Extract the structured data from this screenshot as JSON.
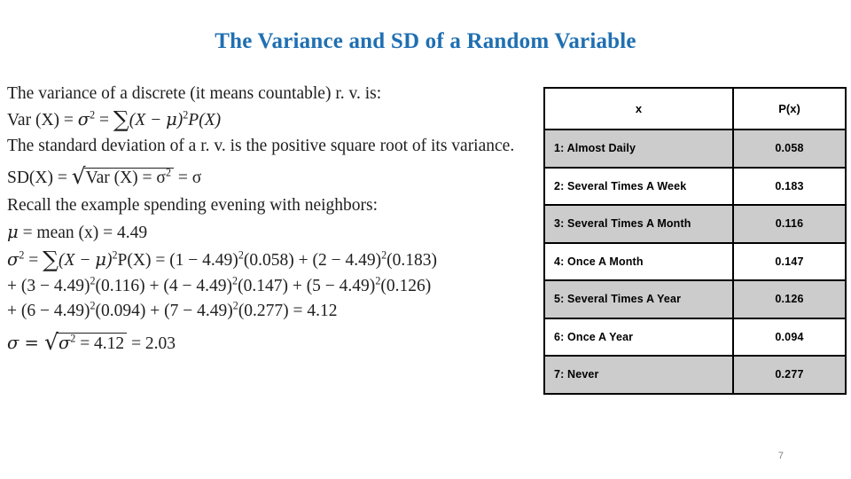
{
  "slide": {
    "title": "The Variance and SD of a Random Variable",
    "title_color": "#1F6FB2",
    "page_number": "7"
  },
  "body": {
    "line_variance_intro": "The variance of a discrete (it means countable) r. v. is:",
    "line_var_formula_lhs": "Var (X) = ",
    "line_var_formula_sigma": "σ",
    "line_var_formula_eq": " = ",
    "line_var_formula_sum": "∑",
    "line_var_formula_rhs_open": "(X  −  ",
    "line_var_formula_mu": "μ",
    "line_var_formula_rhs_close": ")",
    "line_var_formula_px": "P(X)",
    "line_sd_intro": "The standard deviation of a r. v. is the positive square root of its variance.",
    "line_sd_lhs": "SD(X) = ",
    "line_sd_radicand": "Var (X) = σ",
    "line_sd_result": " = σ",
    "line_recall": "Recall the example spending evening with neighbors:",
    "line_mean_sym": "μ",
    "line_mean_rest": " = mean (x) = 4.49",
    "line_sigma2_a_sigma": "σ",
    "line_sigma2_a_eq": " = ",
    "line_sigma2_a_sum": "∑",
    "line_sigma2_a_mid_open": "(X  −  ",
    "line_sigma2_a_mu": "μ",
    "line_sigma2_a_mid_close": ")",
    "line_sigma2_a_px": "P(X) = (1  − 4.49)",
    "line_sigma2_a_t1": "(0.058) + (2  − 4.49)",
    "line_sigma2_a_t2": "(0.183)",
    "line_sigma2_b_p1": "+ (3  − 4.49)",
    "line_sigma2_b_p2": "(0.116) + (4  − 4.49)",
    "line_sigma2_b_p3": "(0.147) + (5  − 4.49)",
    "line_sigma2_b_p4": "(0.126)",
    "line_sigma2_c_p1": "+ (6  − 4.49)",
    "line_sigma2_c_p2": "(0.094) + (7  − 4.49)",
    "line_sigma2_c_p3": "(0.277) = 4.12",
    "line_sd_final_lhs": "σ = ",
    "line_sd_final_radicand": "σ",
    "line_sd_final_radicand_tail": " = 4.12",
    "line_sd_final_result": " = 2.03",
    "exp_two": "2"
  },
  "table": {
    "headers": {
      "x": "x",
      "px": "P(x)"
    },
    "rows": [
      {
        "x": "1: Almost Daily",
        "px": "0.058",
        "shaded": true
      },
      {
        "x": "2: Several Times A Week",
        "px": "0.183",
        "shaded": false
      },
      {
        "x": "3: Several Times A Month",
        "px": "0.116",
        "shaded": true
      },
      {
        "x": "4: Once A Month",
        "px": "0.147",
        "shaded": false
      },
      {
        "x": "5: Several Times A Year",
        "px": "0.126",
        "shaded": true
      },
      {
        "x": "6: Once A Year",
        "px": "0.094",
        "shaded": false
      },
      {
        "x": "7: Never",
        "px": "0.277",
        "shaded": true
      }
    ],
    "shade_color": "#cccccc",
    "border_color": "#000000"
  },
  "chart_data": {
    "type": "table",
    "title": "The Variance and SD of a Random Variable",
    "categories": [
      "1: Almost Daily",
      "2: Several Times A Week",
      "3: Several Times A Month",
      "4: Once A Month",
      "5: Several Times A Year",
      "6: Once A Year",
      "7: Never"
    ],
    "x": [
      1,
      2,
      3,
      4,
      5,
      6,
      7
    ],
    "values": [
      0.058,
      0.183,
      0.116,
      0.147,
      0.126,
      0.094,
      0.277
    ],
    "xlabel": "x",
    "ylabel": "P(x)",
    "statistics": {
      "mean": 4.49,
      "variance": 4.12,
      "sd": 2.03
    }
  }
}
